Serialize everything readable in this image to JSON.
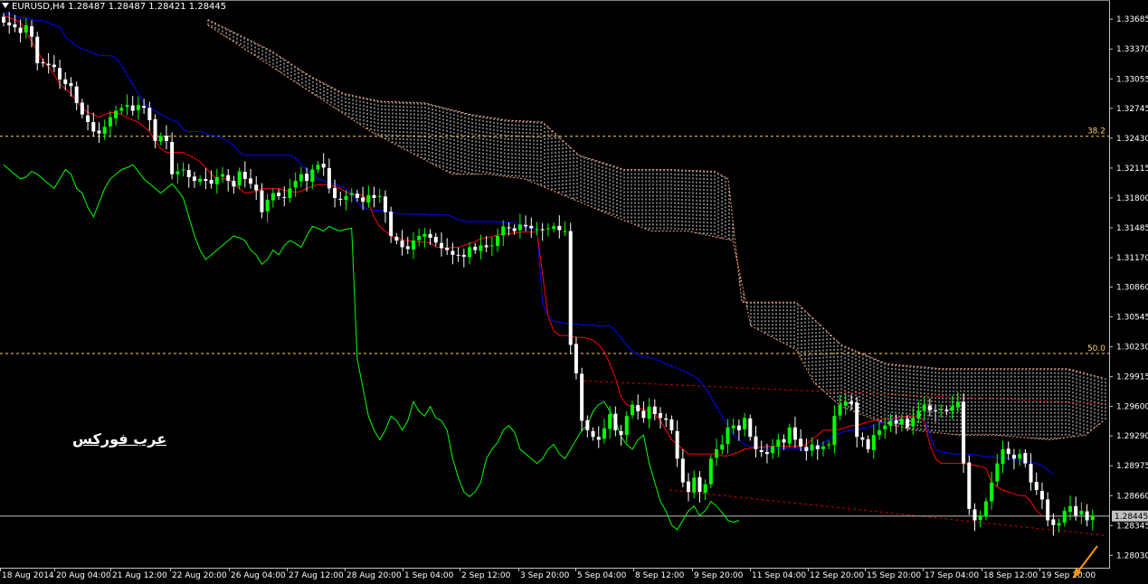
{
  "header": {
    "symbol_info": "EURUSD,H4  1.28487 1.28487 1.28421 1.28445"
  },
  "watermark": "عرب فوركس",
  "colors": {
    "background": "#000000",
    "bull": "#00ff00",
    "bear": "#ffffff",
    "tenkan": "#ff0000",
    "kijun": "#0000ff",
    "chikou": "#00ff00",
    "kumo": "#ffffff",
    "kumo_edge": "#ffa07a",
    "fibo": "#ffd166",
    "trendline": "#ff0000",
    "current_price": "#c0c0c0",
    "arrow": "#ff9900"
  },
  "chart_data": {
    "type": "candlestick",
    "symbol": "EURUSD",
    "timeframe": "H4",
    "ohlc_now": {
      "open": 1.28487,
      "high": 1.28487,
      "low": 1.28421,
      "close": 1.28445
    },
    "current_price": "1.28445",
    "ylim": [
      1.279,
      1.3383
    ],
    "y_ticks": [
      "1.33685",
      "1.33370",
      "1.33055",
      "1.32745",
      "1.32430",
      "1.32115",
      "1.31800",
      "1.31485",
      "1.31170",
      "1.30860",
      "1.30545",
      "1.30230",
      "1.29915",
      "1.29600",
      "1.29290",
      "1.28975",
      "1.28660",
      "1.28345",
      "1.28030"
    ],
    "x_ticks": [
      "18 Aug 2014",
      "20 Aug 04:00",
      "21 Aug 12:00",
      "22 Aug 20:00",
      "26 Aug 04:00",
      "27 Aug 12:00",
      "28 Aug 20:00",
      "1 Sep 04:00",
      "2 Sep 12:00",
      "3 Sep 20:00",
      "5 Sep 04:00",
      "8 Sep 12:00",
      "9 Sep 20:00",
      "11 Sep 04:00",
      "12 Sep 20:00",
      "15 Sep 20:00",
      "17 Sep 04:00",
      "18 Sep 12:00",
      "19 Sep 20:00"
    ],
    "fibo_levels": [
      {
        "label": "38.2",
        "price": 1.3245
      },
      {
        "label": "50.0",
        "price": 1.3016
      }
    ],
    "closes": [
      1.3365,
      1.3362,
      1.336,
      1.3354,
      1.3362,
      1.335,
      1.3322,
      1.3322,
      1.332,
      1.3318,
      1.3305,
      1.33,
      1.3298,
      1.328,
      1.3268,
      1.326,
      1.325,
      1.3248,
      1.3255,
      1.3265,
      1.3272,
      1.3275,
      1.3278,
      1.3272,
      1.3278,
      1.3275,
      1.3262,
      1.324,
      1.3245,
      1.324,
      1.3205,
      1.3208,
      1.321,
      1.3202,
      1.3198,
      1.32,
      1.3198,
      1.3195,
      1.3202,
      1.3205,
      1.3198,
      1.3192,
      1.3208,
      1.32,
      1.3195,
      1.3188,
      1.3165,
      1.3178,
      1.3185,
      1.3182,
      1.318,
      1.319,
      1.3198,
      1.3205,
      1.3198,
      1.321,
      1.3215,
      1.3212,
      1.319,
      1.318,
      1.3178,
      1.3182,
      1.3185,
      1.318,
      1.3176,
      1.3183,
      1.318,
      1.3182,
      1.3165,
      1.314,
      1.3135,
      1.3128,
      1.3126,
      1.3135,
      1.314,
      1.3142,
      1.3138,
      1.3133,
      1.3127,
      1.3125,
      1.312,
      1.3119,
      1.3118,
      1.3128,
      1.3125,
      1.313,
      1.3128,
      1.313,
      1.314,
      1.315,
      1.3148,
      1.3145,
      1.3152,
      1.315,
      1.3148,
      1.3147,
      1.3146,
      1.3148,
      1.315,
      1.3146,
      1.3145,
      1.3025,
      1.2995,
      1.2945,
      1.2935,
      1.2928,
      1.2925,
      1.2937,
      1.2952,
      1.2935,
      1.293,
      1.295,
      1.2962,
      1.2955,
      1.2948,
      1.296,
      1.2952,
      1.2948,
      1.2946,
      1.2935,
      1.2905,
      1.288,
      1.287,
      1.2885,
      1.287,
      1.2878,
      1.2905,
      1.2915,
      1.292,
      1.2938,
      1.294,
      1.2935,
      1.2948,
      1.2928,
      1.2915,
      1.2912,
      1.291,
      1.2918,
      1.2925,
      1.2922,
      1.2938,
      1.2925,
      1.2918,
      1.2913,
      1.292,
      1.2915,
      1.2918,
      1.292,
      1.295,
      1.2962,
      1.2965,
      1.2963,
      1.2928,
      1.2925,
      1.2915,
      1.293,
      1.2935,
      1.294,
      1.2945,
      1.2942,
      1.2947,
      1.2938,
      1.2948,
      1.2955,
      1.2962,
      1.2956,
      1.2955,
      1.2957,
      1.2955,
      1.296,
      1.2965,
      1.29,
      1.2852,
      1.284,
      1.2845,
      1.286,
      1.288,
      1.29,
      1.2915,
      1.291,
      1.2905,
      1.291,
      1.29,
      1.288,
      1.2872,
      1.2862,
      1.284,
      1.2835,
      1.2837,
      1.285,
      1.2855,
      1.2845,
      1.285,
      1.284,
      1.2845
    ],
    "tenkan": [
      1.3372,
      1.337,
      1.3368,
      1.3365,
      1.3355,
      1.3345,
      1.3335,
      1.3325,
      1.3318,
      1.331,
      1.33,
      1.3295,
      1.329,
      1.3282,
      1.3275,
      1.327,
      1.3268,
      1.3265,
      1.3268,
      1.327,
      1.327,
      1.3268,
      1.3265,
      1.3262,
      1.326,
      1.3255,
      1.325,
      1.324,
      1.3232,
      1.3228,
      1.3228,
      1.3228,
      1.3228,
      1.3225,
      1.3222,
      1.3218,
      1.3212,
      1.3205,
      1.32,
      1.32,
      1.32,
      1.3195,
      1.319,
      1.3185,
      1.3186,
      1.3187,
      1.319,
      1.319,
      1.319,
      1.319,
      1.3188,
      1.3187,
      1.3186,
      1.3187,
      1.319,
      1.3192,
      1.3194,
      1.3194,
      1.3194,
      1.3192,
      1.319,
      1.3186,
      1.3184,
      1.3183,
      1.3183,
      1.3175,
      1.316,
      1.315,
      1.3145,
      1.314,
      1.3138,
      1.3136,
      1.3135,
      1.3134,
      1.3134,
      1.3133,
      1.3133,
      1.3128,
      1.3128,
      1.3127,
      1.3128,
      1.3128,
      1.313,
      1.3132,
      1.3134,
      1.3137,
      1.3138,
      1.3139,
      1.3141,
      1.3142,
      1.3142,
      1.3143,
      1.3144,
      1.3144,
      1.3144,
      1.3144,
      1.31,
      1.3055,
      1.304,
      1.3035,
      1.3035,
      1.3034,
      1.3033,
      1.3033,
      1.3032,
      1.303,
      1.3025,
      1.3018,
      1.3005,
      1.299,
      1.297,
      1.2962,
      1.296,
      1.2958,
      1.2957,
      1.2955,
      1.2952,
      1.2945,
      1.2935,
      1.2925,
      1.292,
      1.2915,
      1.291,
      1.291,
      1.291,
      1.291,
      1.291,
      1.291,
      1.2908,
      1.2908,
      1.291,
      1.2912,
      1.2915,
      1.2916,
      1.2917,
      1.2917,
      1.2918,
      1.2918,
      1.2918,
      1.2918,
      1.2918,
      1.2918,
      1.2918,
      1.292,
      1.2925,
      1.293,
      1.2935,
      1.2935,
      1.2935,
      1.2936,
      1.2938,
      1.294,
      1.294,
      1.2942,
      1.2944,
      1.2945,
      1.2946,
      1.2947,
      1.2948,
      1.2948,
      1.2949,
      1.295,
      1.295,
      1.295,
      1.2945,
      1.292,
      1.2905,
      1.29,
      1.29,
      1.29,
      1.29,
      1.29,
      1.2899,
      1.2898,
      1.2897,
      1.2895,
      1.288,
      1.2875,
      1.2872,
      1.287,
      1.2868,
      1.2866,
      1.2866,
      1.286,
      1.285,
      1.2845
    ],
    "kijun": [
      1.3375,
      1.3374,
      1.3372,
      1.337,
      1.337,
      1.3368,
      1.3367,
      1.3367,
      1.3365,
      1.3362,
      1.336,
      1.335,
      1.3345,
      1.334,
      1.3337,
      1.3335,
      1.3333,
      1.333,
      1.333,
      1.333,
      1.3328,
      1.332,
      1.331,
      1.33,
      1.329,
      1.328,
      1.3275,
      1.3272,
      1.3268,
      1.3265,
      1.3262,
      1.326,
      1.3252,
      1.325,
      1.325,
      1.325,
      1.3248,
      1.3246,
      1.3245,
      1.3243,
      1.324,
      1.3235,
      1.3228,
      1.3225,
      1.3225,
      1.3225,
      1.3225,
      1.3225,
      1.3225,
      1.3225,
      1.3225,
      1.3225,
      1.3222,
      1.3215,
      1.321,
      1.3205,
      1.32,
      1.3198,
      1.3196,
      1.3195,
      1.3192,
      1.319,
      1.3185,
      1.3175,
      1.317,
      1.3168,
      1.3167,
      1.3167,
      1.3166,
      1.3165,
      1.3164,
      1.3163,
      1.3163,
      1.3163,
      1.3163,
      1.3163,
      1.3162,
      1.3162,
      1.3162,
      1.3162,
      1.316,
      1.3157,
      1.3156,
      1.3155,
      1.3155,
      1.3155,
      1.3155,
      1.3155,
      1.3155,
      1.3154,
      1.3154,
      1.3154,
      1.315,
      1.3149,
      1.3148,
      1.3147,
      1.307,
      1.3055,
      1.305,
      1.3049,
      1.3048,
      1.3047,
      1.3047,
      1.3046,
      1.3046,
      1.3046,
      1.3045,
      1.3045,
      1.3045,
      1.304,
      1.3032,
      1.3025,
      1.3018,
      1.3015,
      1.3012,
      1.3012,
      1.301,
      1.3008,
      1.3005,
      1.3003,
      1.3,
      1.2998,
      1.2995,
      1.2992,
      1.2988,
      1.298,
      1.297,
      1.296,
      1.295,
      1.294,
      1.293,
      1.2925,
      1.292,
      1.2918,
      1.2917,
      1.2917,
      1.2916,
      1.2916,
      1.2915,
      1.2915,
      1.2915,
      1.2915,
      1.2915,
      1.2915,
      1.2915,
      1.2918,
      1.2922,
      1.2925,
      1.293,
      1.2932,
      1.2934,
      1.2935,
      1.2936,
      1.2937,
      1.2938,
      1.294,
      1.2942,
      1.2944,
      1.2945,
      1.2946,
      1.2948,
      1.295,
      1.295,
      1.295,
      1.2946,
      1.293,
      1.2915,
      1.2912,
      1.2911,
      1.291,
      1.291,
      1.291,
      1.291,
      1.2909,
      1.2908,
      1.2907,
      1.2907,
      1.2906,
      1.2906,
      1.2905,
      1.2904,
      1.2903,
      1.2902,
      1.2901,
      1.29,
      1.2898,
      1.2893,
      1.2888
    ],
    "chikou": [
      1.3215,
      1.321,
      1.3205,
      1.32,
      1.3202,
      1.3208,
      1.3205,
      1.32,
      1.3195,
      1.319,
      1.32,
      1.321,
      1.3205,
      1.319,
      1.3185,
      1.317,
      1.316,
      1.3175,
      1.319,
      1.32,
      1.3205,
      1.321,
      1.3212,
      1.3215,
      1.3208,
      1.32,
      1.3195,
      1.319,
      1.3185,
      1.319,
      1.3195,
      1.3188,
      1.318,
      1.316,
      1.314,
      1.3125,
      1.3115,
      1.312,
      1.3125,
      1.313,
      1.3135,
      1.314,
      1.3138,
      1.3135,
      1.3125,
      1.312,
      1.311,
      1.3115,
      1.3125,
      1.312,
      1.313,
      1.3135,
      1.3132,
      1.3128,
      1.314,
      1.315,
      1.3148,
      1.3145,
      1.315,
      1.3147,
      1.3145,
      1.3147,
      1.3148,
      1.301,
      1.298,
      1.295,
      1.2935,
      1.2925,
      1.2935,
      1.295,
      1.2945,
      1.2935,
      1.2945,
      1.2965,
      1.2955,
      1.295,
      1.296,
      1.2948,
      1.2945,
      1.2935,
      1.2905,
      1.2885,
      1.287,
      1.2865,
      1.287,
      1.288,
      1.2905,
      1.2915,
      1.2922,
      1.2935,
      1.294,
      1.2933,
      1.2915,
      1.291,
      1.2905,
      1.29,
      1.2905,
      1.2915,
      1.292,
      1.291,
      1.2905,
      1.2915,
      1.2925,
      1.2935,
      1.294,
      1.2955,
      1.2962,
      1.2965,
      1.2955,
      1.2945,
      1.2928,
      1.292,
      1.2915,
      1.2925,
      1.293,
      1.29,
      1.288,
      1.286,
      1.285,
      1.2835,
      1.283,
      1.284,
      1.285,
      1.2855,
      1.2845,
      1.285,
      1.286,
      1.2855,
      1.2848,
      1.284,
      1.2838,
      1.284
    ]
  }
}
